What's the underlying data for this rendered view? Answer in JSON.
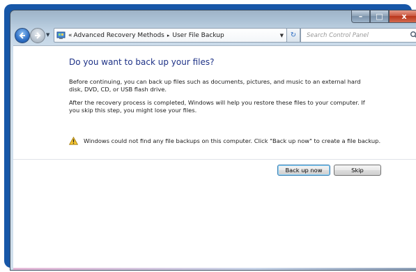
{
  "window": {
    "caption": {
      "minimize_glyph": "–",
      "maximize_glyph": "□",
      "close_glyph": "x"
    }
  },
  "navigation": {
    "breadcrumb": {
      "overflow": "«",
      "items": [
        "Advanced Recovery Methods",
        "User File Backup"
      ],
      "separator": "▸"
    },
    "refresh_glyph": "↻",
    "search": {
      "placeholder": "Search Control Panel"
    }
  },
  "main": {
    "title": "Do you want to back up your files?",
    "paragraph_1": "Before continuing, you can back up files such as documents, pictures, and music to an external hard disk, DVD, CD, or USB flash drive.",
    "paragraph_2": "After the recovery process is completed, Windows will help you restore these files to  your computer.  If you skip this step, you might lose your files.",
    "warning": "Windows could not find any file backups on this computer. Click \"Back up now\" to create a file backup.",
    "buttons": {
      "back_up_now": "Back up now",
      "skip": "Skip"
    }
  },
  "icons": {
    "back": "back-arrow-icon",
    "forward": "forward-arrow-icon",
    "address": "control-panel-icon",
    "search": "search-icon",
    "warning": "warning-icon"
  },
  "colors": {
    "title_text": "#1e3287",
    "close_button": "#c9553e",
    "frame_blue": "#1757a8"
  }
}
